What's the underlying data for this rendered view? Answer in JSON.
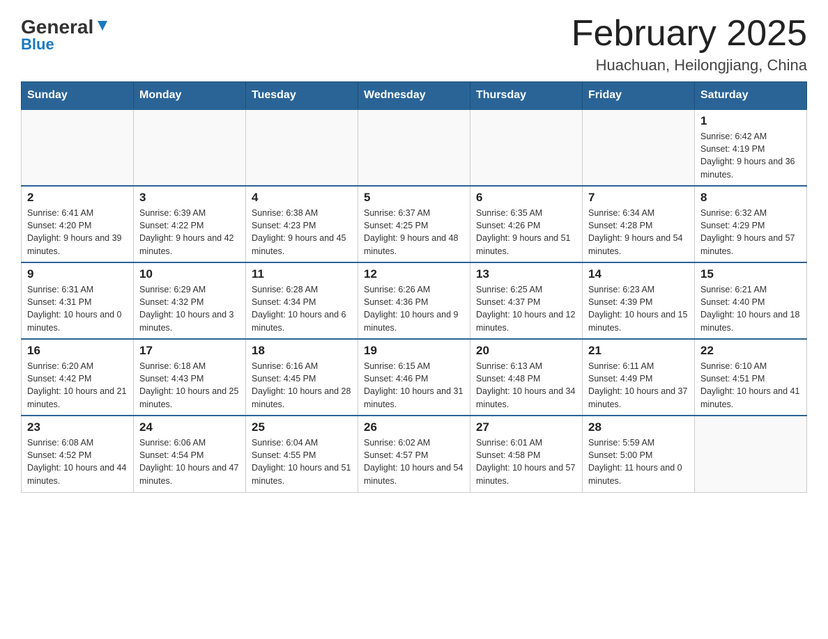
{
  "header": {
    "logo_general": "General",
    "logo_blue": "Blue",
    "month_title": "February 2025",
    "location": "Huachuan, Heilongjiang, China"
  },
  "weekdays": [
    "Sunday",
    "Monday",
    "Tuesday",
    "Wednesday",
    "Thursday",
    "Friday",
    "Saturday"
  ],
  "weeks": [
    [
      {
        "day": "",
        "info": ""
      },
      {
        "day": "",
        "info": ""
      },
      {
        "day": "",
        "info": ""
      },
      {
        "day": "",
        "info": ""
      },
      {
        "day": "",
        "info": ""
      },
      {
        "day": "",
        "info": ""
      },
      {
        "day": "1",
        "info": "Sunrise: 6:42 AM\nSunset: 4:19 PM\nDaylight: 9 hours and 36 minutes."
      }
    ],
    [
      {
        "day": "2",
        "info": "Sunrise: 6:41 AM\nSunset: 4:20 PM\nDaylight: 9 hours and 39 minutes."
      },
      {
        "day": "3",
        "info": "Sunrise: 6:39 AM\nSunset: 4:22 PM\nDaylight: 9 hours and 42 minutes."
      },
      {
        "day": "4",
        "info": "Sunrise: 6:38 AM\nSunset: 4:23 PM\nDaylight: 9 hours and 45 minutes."
      },
      {
        "day": "5",
        "info": "Sunrise: 6:37 AM\nSunset: 4:25 PM\nDaylight: 9 hours and 48 minutes."
      },
      {
        "day": "6",
        "info": "Sunrise: 6:35 AM\nSunset: 4:26 PM\nDaylight: 9 hours and 51 minutes."
      },
      {
        "day": "7",
        "info": "Sunrise: 6:34 AM\nSunset: 4:28 PM\nDaylight: 9 hours and 54 minutes."
      },
      {
        "day": "8",
        "info": "Sunrise: 6:32 AM\nSunset: 4:29 PM\nDaylight: 9 hours and 57 minutes."
      }
    ],
    [
      {
        "day": "9",
        "info": "Sunrise: 6:31 AM\nSunset: 4:31 PM\nDaylight: 10 hours and 0 minutes."
      },
      {
        "day": "10",
        "info": "Sunrise: 6:29 AM\nSunset: 4:32 PM\nDaylight: 10 hours and 3 minutes."
      },
      {
        "day": "11",
        "info": "Sunrise: 6:28 AM\nSunset: 4:34 PM\nDaylight: 10 hours and 6 minutes."
      },
      {
        "day": "12",
        "info": "Sunrise: 6:26 AM\nSunset: 4:36 PM\nDaylight: 10 hours and 9 minutes."
      },
      {
        "day": "13",
        "info": "Sunrise: 6:25 AM\nSunset: 4:37 PM\nDaylight: 10 hours and 12 minutes."
      },
      {
        "day": "14",
        "info": "Sunrise: 6:23 AM\nSunset: 4:39 PM\nDaylight: 10 hours and 15 minutes."
      },
      {
        "day": "15",
        "info": "Sunrise: 6:21 AM\nSunset: 4:40 PM\nDaylight: 10 hours and 18 minutes."
      }
    ],
    [
      {
        "day": "16",
        "info": "Sunrise: 6:20 AM\nSunset: 4:42 PM\nDaylight: 10 hours and 21 minutes."
      },
      {
        "day": "17",
        "info": "Sunrise: 6:18 AM\nSunset: 4:43 PM\nDaylight: 10 hours and 25 minutes."
      },
      {
        "day": "18",
        "info": "Sunrise: 6:16 AM\nSunset: 4:45 PM\nDaylight: 10 hours and 28 minutes."
      },
      {
        "day": "19",
        "info": "Sunrise: 6:15 AM\nSunset: 4:46 PM\nDaylight: 10 hours and 31 minutes."
      },
      {
        "day": "20",
        "info": "Sunrise: 6:13 AM\nSunset: 4:48 PM\nDaylight: 10 hours and 34 minutes."
      },
      {
        "day": "21",
        "info": "Sunrise: 6:11 AM\nSunset: 4:49 PM\nDaylight: 10 hours and 37 minutes."
      },
      {
        "day": "22",
        "info": "Sunrise: 6:10 AM\nSunset: 4:51 PM\nDaylight: 10 hours and 41 minutes."
      }
    ],
    [
      {
        "day": "23",
        "info": "Sunrise: 6:08 AM\nSunset: 4:52 PM\nDaylight: 10 hours and 44 minutes."
      },
      {
        "day": "24",
        "info": "Sunrise: 6:06 AM\nSunset: 4:54 PM\nDaylight: 10 hours and 47 minutes."
      },
      {
        "day": "25",
        "info": "Sunrise: 6:04 AM\nSunset: 4:55 PM\nDaylight: 10 hours and 51 minutes."
      },
      {
        "day": "26",
        "info": "Sunrise: 6:02 AM\nSunset: 4:57 PM\nDaylight: 10 hours and 54 minutes."
      },
      {
        "day": "27",
        "info": "Sunrise: 6:01 AM\nSunset: 4:58 PM\nDaylight: 10 hours and 57 minutes."
      },
      {
        "day": "28",
        "info": "Sunrise: 5:59 AM\nSunset: 5:00 PM\nDaylight: 11 hours and 0 minutes."
      },
      {
        "day": "",
        "info": ""
      }
    ]
  ]
}
